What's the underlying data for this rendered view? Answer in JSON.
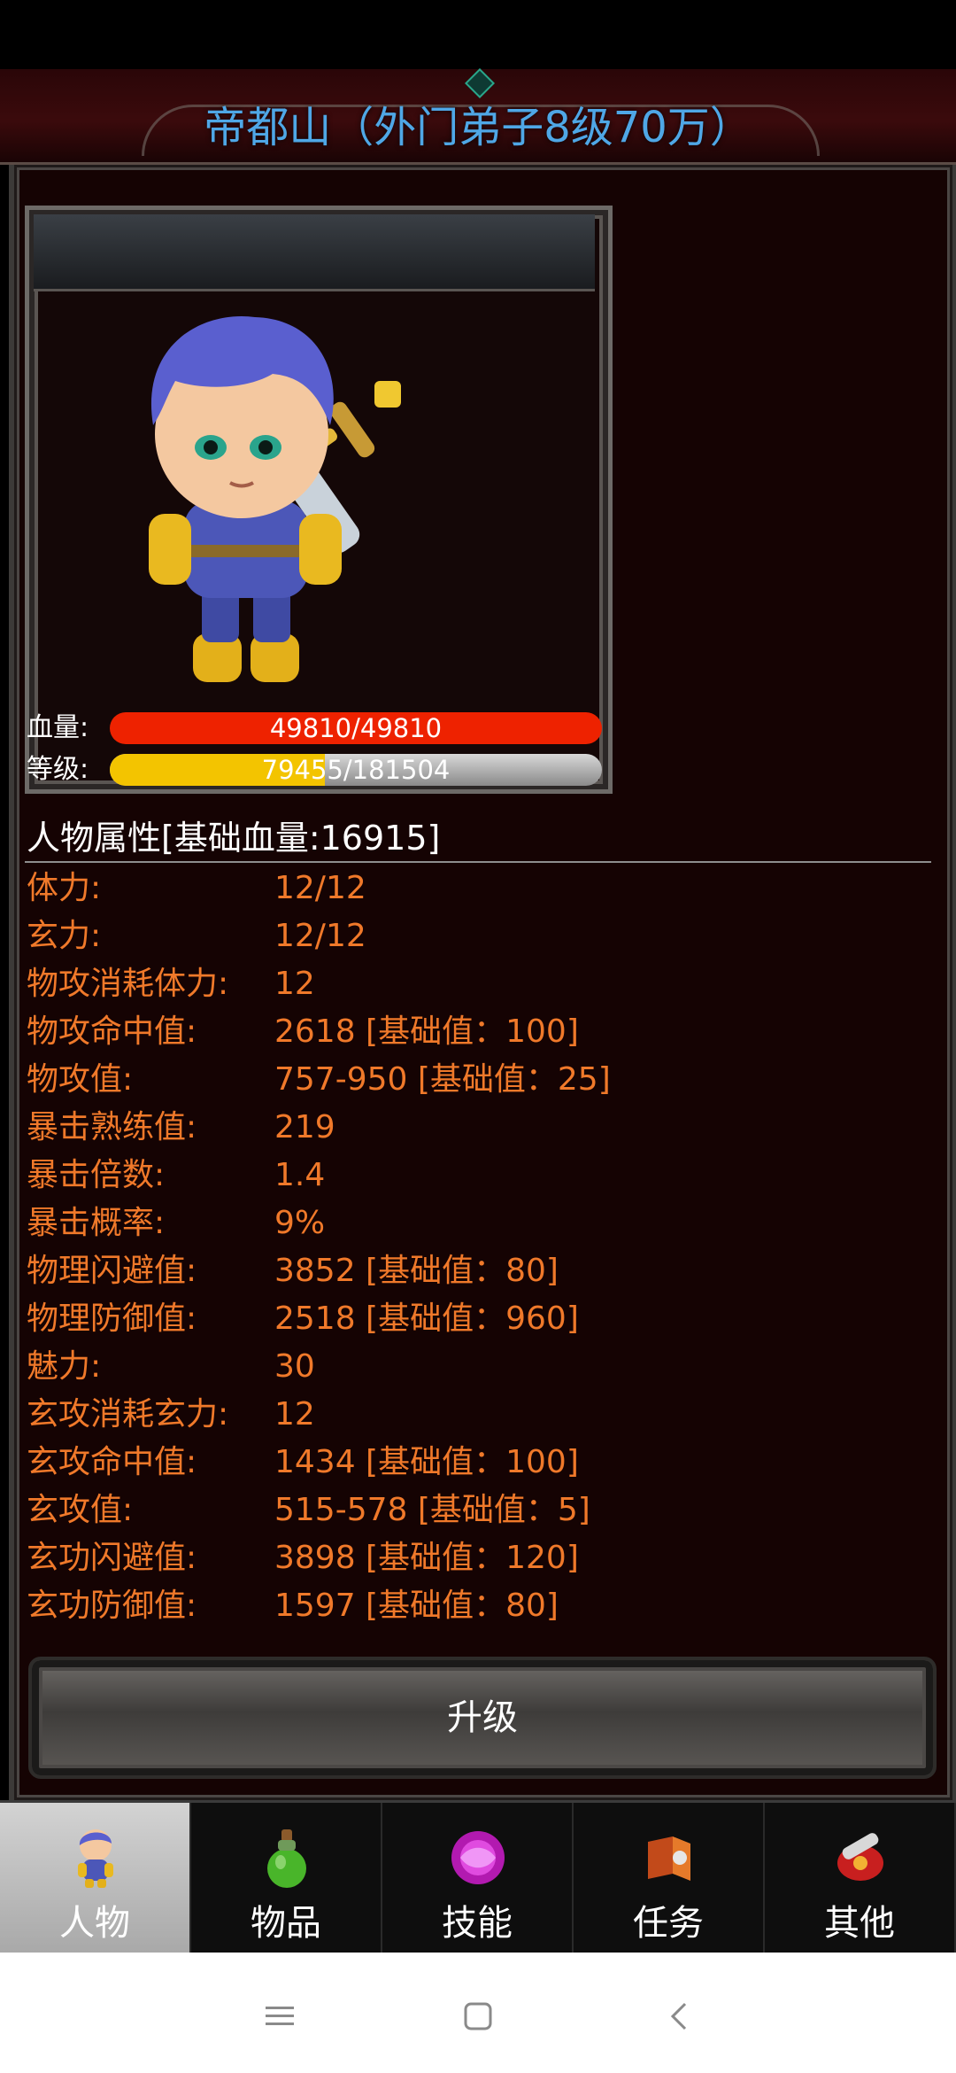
{
  "header": {
    "title": "帝都山（外门弟子8级70万）"
  },
  "portrait": {
    "hp_label": "血量:",
    "hp_text": "49810/49810",
    "level_label": "等级:",
    "exp_text": "79455/181504",
    "exp_fraction": 0.4378
  },
  "attributes": {
    "title": "人物属性[基础血量:16915]",
    "rows": [
      {
        "name": "体力:",
        "value": "12/12"
      },
      {
        "name": "玄力:",
        "value": "12/12"
      },
      {
        "name": "物攻消耗体力:",
        "value": "12"
      },
      {
        "name": "物攻命中值:",
        "value": "2618 [基础值：100]"
      },
      {
        "name": "物攻值:",
        "value": "757-950 [基础值：25]"
      },
      {
        "name": "暴击熟练值:",
        "value": "219"
      },
      {
        "name": "暴击倍数:",
        "value": "1.4"
      },
      {
        "name": "暴击概率:",
        "value": "9%"
      },
      {
        "name": "物理闪避值:",
        "value": "3852 [基础值：80]"
      },
      {
        "name": "物理防御值:",
        "value": "2518 [基础值：960]"
      },
      {
        "name": "魅力:",
        "value": "30"
      },
      {
        "name": "玄攻消耗玄力:",
        "value": "12"
      },
      {
        "name": "玄攻命中值:",
        "value": "1434 [基础值：100]"
      },
      {
        "name": "玄攻值:",
        "value": "515-578 [基础值：5]"
      },
      {
        "name": "玄功闪避值:",
        "value": "3898 [基础值：120]"
      },
      {
        "name": "玄功防御值:",
        "value": "1597 [基础值：80]"
      }
    ]
  },
  "actions": {
    "upgrade_label": "升级"
  },
  "tabs": [
    {
      "label": "人物",
      "icon": "character-icon",
      "active": true
    },
    {
      "label": "物品",
      "icon": "potion-icon",
      "active": false
    },
    {
      "label": "技能",
      "icon": "skill-orb-icon",
      "active": false
    },
    {
      "label": "任务",
      "icon": "quest-icon",
      "active": false
    },
    {
      "label": "其他",
      "icon": "other-icon",
      "active": false
    }
  ],
  "system_nav": [
    "menu-icon",
    "home-icon",
    "back-icon"
  ]
}
